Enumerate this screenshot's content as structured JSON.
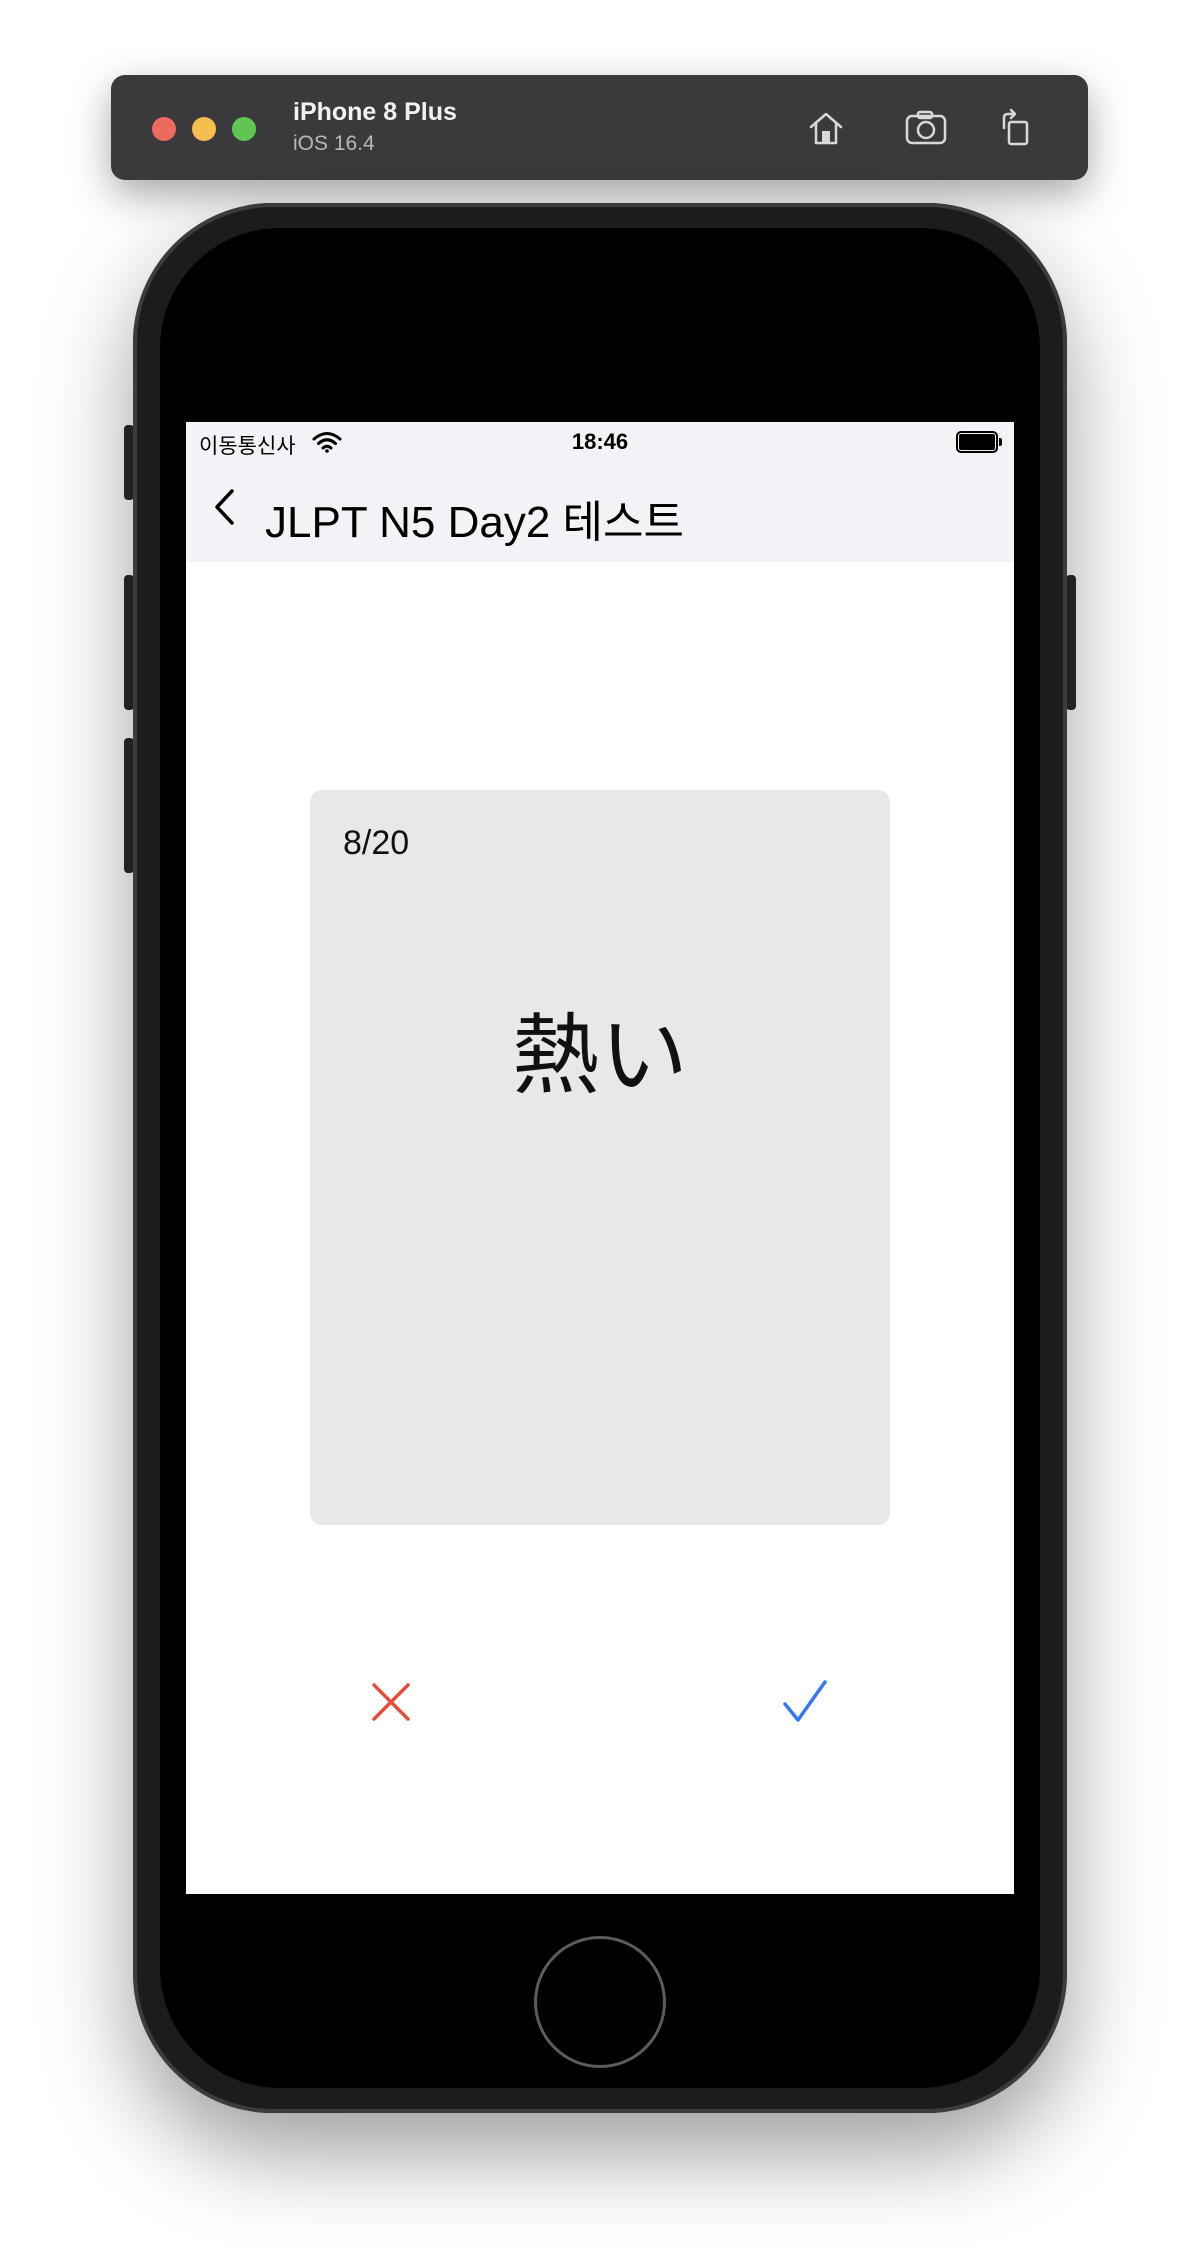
{
  "simulator": {
    "device_name": "iPhone 8 Plus",
    "os_version": "iOS 16.4",
    "toolbar_icons": [
      "home-icon",
      "screenshot-icon",
      "rotate-icon"
    ]
  },
  "status_bar": {
    "carrier": "이동통신사",
    "time": "18:46"
  },
  "nav": {
    "back_icon": "chevron-left-icon",
    "title": "JLPT N5 Day2 테스트"
  },
  "card": {
    "counter": "8/20",
    "word": "熱い"
  },
  "actions": {
    "wrong_icon": "x-mark-icon",
    "right_icon": "checkmark-icon"
  },
  "colors": {
    "nav_background": "#f2f2f7",
    "card_background": "#e8e8ea",
    "wrong_red": "#e74c3c",
    "right_blue": "#3478f6"
  }
}
